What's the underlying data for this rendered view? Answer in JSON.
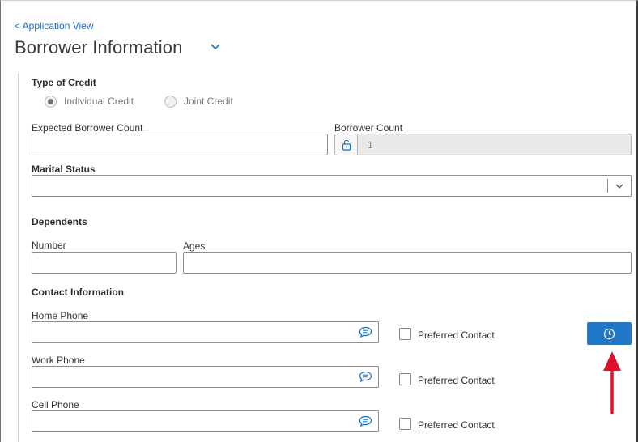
{
  "nav": {
    "back_link": "< Application View"
  },
  "header": {
    "title": "Borrower Information"
  },
  "type_of_credit": {
    "label": "Type of Credit",
    "options": [
      {
        "label": "Individual Credit",
        "selected": true
      },
      {
        "label": "Joint Credit",
        "selected": false
      }
    ]
  },
  "expected_borrower_count": {
    "label": "Expected Borrower Count",
    "value": ""
  },
  "borrower_count": {
    "label": "Borrower Count",
    "value": "1"
  },
  "marital_status": {
    "label": "Marital Status",
    "value": ""
  },
  "dependents": {
    "heading": "Dependents",
    "number_label": "Number",
    "number_value": "",
    "ages_label": "Ages",
    "ages_value": ""
  },
  "contact": {
    "heading": "Contact Information",
    "phones": [
      {
        "label": "Home Phone",
        "value": "",
        "preferred_label": "Preferred Contact",
        "preferred": false
      },
      {
        "label": "Work Phone",
        "value": "",
        "preferred_label": "Preferred Contact",
        "preferred": false
      },
      {
        "label": "Cell Phone",
        "value": "",
        "preferred_label": "Preferred Contact",
        "preferred": false
      }
    ]
  },
  "colors": {
    "accent": "#1f78c8",
    "link": "#1a6fc4",
    "annotation": "#e0102a"
  },
  "icons": [
    "chevron-down-icon",
    "unlock-icon",
    "chat-bubble-icon",
    "clock-icon",
    "red-up-arrow-annotation"
  ]
}
